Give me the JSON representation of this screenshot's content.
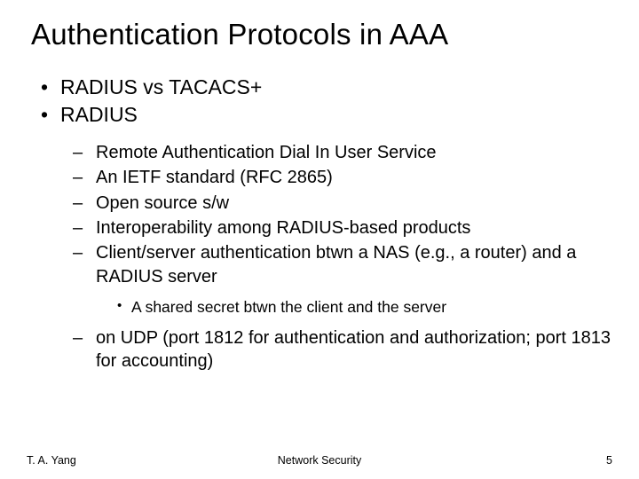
{
  "title": "Authentication Protocols in AAA",
  "bullets": {
    "b1": "RADIUS vs TACACS+",
    "b2": "RADIUS",
    "sub": {
      "s1": "Remote Authentication Dial In User Service",
      "s2": "An IETF standard (RFC 2865)",
      "s3": "Open source s/w",
      "s4": "Interoperability among RADIUS-based products",
      "s5": "Client/server authentication btwn a NAS (e.g., a router) and a RADIUS server",
      "s5_note": "A shared secret btwn the client and the server",
      "s6": "on UDP (port 1812 for authentication and authorization; port 1813 for accounting)"
    }
  },
  "footer": {
    "author": "T. A. Yang",
    "center": "Network Security",
    "page": "5"
  }
}
